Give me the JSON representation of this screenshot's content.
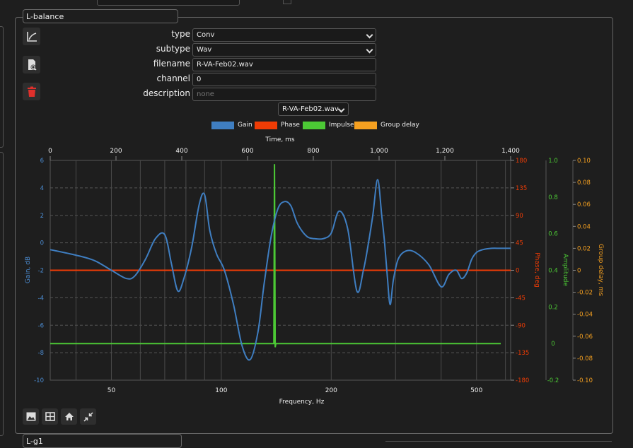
{
  "panel": {
    "title": "L-balance",
    "next_title": "L-g1"
  },
  "form": {
    "type_label": "type",
    "type_value": "Conv",
    "subtype_label": "subtype",
    "subtype_value": "Wav",
    "filename_label": "filename",
    "filename_value": "R-VA-Feb02.wav",
    "channel_label": "channel",
    "channel_value": "0",
    "description_label": "description",
    "description_placeholder": "none"
  },
  "chart_selector": {
    "selected": "R-VA-Feb02.wav"
  },
  "legend": [
    {
      "label": "Gain",
      "color": "#3f7ec1"
    },
    {
      "label": "Phase",
      "color": "#f03c05"
    },
    {
      "label": "Impulse",
      "color": "#4cc935"
    },
    {
      "label": "Group delay",
      "color": "#f5a020"
    }
  ],
  "icons": {
    "plot": "chart-line-icon",
    "inspect": "file-search-icon",
    "delete": "trash-icon",
    "image": "image-icon",
    "table": "table-icon",
    "home": "home-icon",
    "shrink": "shrink-icon"
  },
  "colors": {
    "gain": "#3f7ec1",
    "phase": "#f03c05",
    "impulse": "#4cc935",
    "group_delay": "#f5a020"
  },
  "chart_data": {
    "type": "line",
    "top_axis": {
      "label": "Time, ms",
      "ticks": [
        "0",
        "200",
        "400",
        "600",
        "800",
        "1,000",
        "1,200",
        "1,400"
      ],
      "range": [
        0,
        1400
      ]
    },
    "bottom_axis": {
      "label": "Frequency, Hz",
      "scale": "log",
      "ticks": [
        "50",
        "100",
        "200",
        "500"
      ],
      "range": [
        34,
        620
      ]
    },
    "gain_axis": {
      "label": "Gain, dB",
      "ticks": [
        "6",
        "4",
        "2",
        "0",
        "-2",
        "-4",
        "-6",
        "-8",
        "-10"
      ],
      "range": [
        -10,
        6
      ]
    },
    "phase_axis": {
      "label": "Phase, deg",
      "ticks": [
        "180",
        "135",
        "90",
        "45",
        "0",
        "-45",
        "-90",
        "-135",
        "-180"
      ],
      "range": [
        -180,
        180
      ]
    },
    "amplitude_axis": {
      "label": "Amplitude",
      "ticks": [
        "1.0",
        "0.8",
        "0.6",
        "0.4",
        "0.2",
        "0",
        "-0.2"
      ],
      "range": [
        -0.2,
        1.0
      ]
    },
    "group_delay_axis": {
      "label": "Group delay, ms",
      "ticks": [
        "0.10",
        "0.08",
        "0.06",
        "0.04",
        "0.02",
        "0",
        "-0.02",
        "-0.04",
        "-0.06",
        "-0.08",
        "-0.10"
      ],
      "range": [
        -0.1,
        0.1
      ]
    },
    "grid": true,
    "series": [
      {
        "name": "Gain",
        "axis": "frequency",
        "x": [
          34,
          40,
          45,
          50,
          55,
          58,
          62,
          66,
          70,
          73,
          76,
          79,
          83,
          87,
          90,
          93,
          97,
          102,
          108,
          114,
          120,
          126,
          131,
          137,
          143,
          149,
          155,
          161,
          167,
          173,
          180,
          190,
          200,
          210,
          222,
          235,
          245,
          253,
          260,
          268,
          275,
          280,
          285,
          290,
          296,
          305,
          320,
          340,
          370,
          400,
          420,
          440,
          455,
          470,
          485,
          500,
          520,
          550,
          580,
          620
        ],
        "y": [
          -0.5,
          -0.9,
          -1.3,
          -2.0,
          -2.6,
          -2.4,
          -1.2,
          0.3,
          0.6,
          -1.5,
          -3.5,
          -2.6,
          -0.3,
          2.8,
          3.5,
          0.9,
          -0.8,
          -2.0,
          -4.5,
          -7.5,
          -8.5,
          -6.5,
          -3.0,
          0.5,
          2.5,
          3.0,
          2.7,
          1.5,
          0.8,
          0.4,
          0.3,
          0.3,
          0.7,
          2.3,
          1.0,
          -3.5,
          -2.0,
          0.0,
          2.0,
          4.6,
          2.0,
          0.0,
          -2.5,
          -4.5,
          -2.7,
          -1.2,
          -0.6,
          -0.7,
          -1.6,
          -3.2,
          -2.3,
          -2.0,
          -2.6,
          -2.2,
          -1.2,
          -0.7,
          -0.5,
          -0.4,
          -0.4,
          -0.4
        ]
      },
      {
        "name": "Phase",
        "axis": "frequency",
        "x": [
          34,
          620
        ],
        "y": [
          0,
          0
        ]
      },
      {
        "name": "Impulse",
        "axis": "time",
        "x": [
          0,
          680,
          682,
          684,
          686,
          688,
          1370
        ],
        "y": [
          0.0,
          0.0,
          0.98,
          -0.02,
          0.0,
          0.0,
          0.0
        ]
      },
      {
        "name": "Group delay",
        "axis": "time",
        "x": [],
        "y": []
      }
    ]
  }
}
